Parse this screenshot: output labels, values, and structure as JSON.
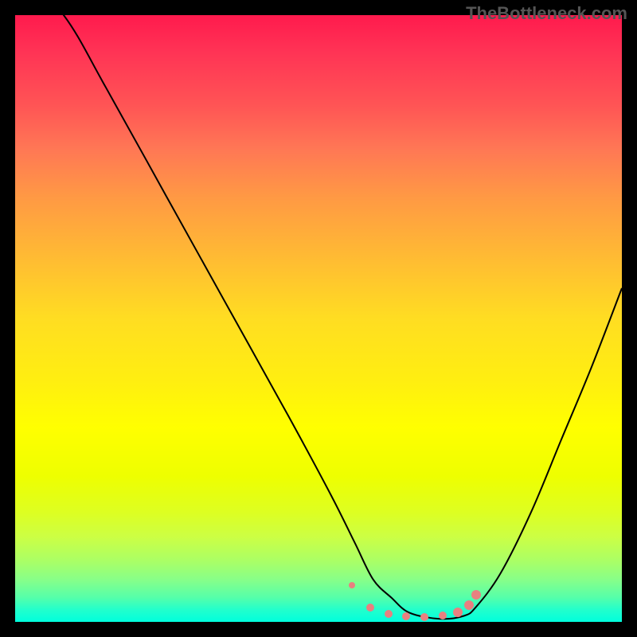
{
  "watermark": "TheBottleneck.com",
  "chart_data": {
    "type": "line",
    "title": "",
    "xlabel": "",
    "ylabel": "",
    "xlim": [
      0,
      100
    ],
    "ylim": [
      0,
      100
    ],
    "series": [
      {
        "name": "curve",
        "x": [
          0,
          8,
          15,
          25,
          35,
          45,
          52,
          56,
          59,
          62,
          65,
          70,
          74,
          76,
          80,
          85,
          90,
          95,
          100
        ],
        "y": [
          108,
          100,
          88,
          70,
          52,
          34,
          21,
          13,
          7,
          4,
          1.5,
          0.5,
          1,
          2.5,
          8,
          18,
          30,
          42,
          55
        ]
      }
    ],
    "markers": {
      "color": "#e88080",
      "points": [
        {
          "x": 55.5,
          "y": 6.0,
          "r": 4
        },
        {
          "x": 58.5,
          "y": 2.3,
          "r": 5
        },
        {
          "x": 61.5,
          "y": 1.3,
          "r": 5
        },
        {
          "x": 64.5,
          "y": 0.9,
          "r": 5
        },
        {
          "x": 67.5,
          "y": 0.8,
          "r": 5
        },
        {
          "x": 70.5,
          "y": 1.0,
          "r": 5
        },
        {
          "x": 73.0,
          "y": 1.6,
          "r": 6
        },
        {
          "x": 74.8,
          "y": 2.8,
          "r": 6
        },
        {
          "x": 76.0,
          "y": 4.5,
          "r": 6
        }
      ]
    },
    "background_gradient": {
      "top": "#ff1a4d",
      "bottom": "#00ffdd"
    }
  }
}
